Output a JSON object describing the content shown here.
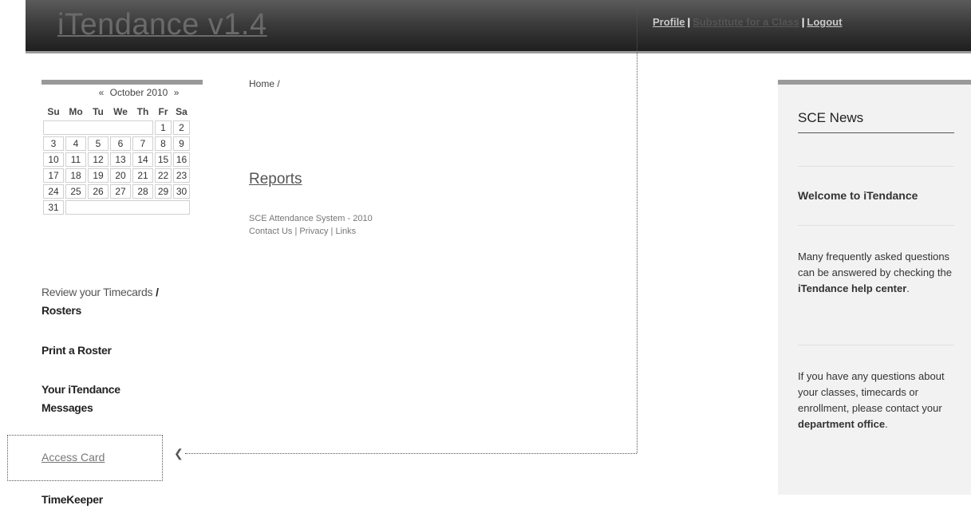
{
  "header": {
    "logo": "iTendance v1.4",
    "nav": {
      "profile": "Profile",
      "substitute": "Substitute for a Class",
      "logout": "Logout",
      "separator": "|"
    }
  },
  "calendar": {
    "prev": "«",
    "month": "October 2010",
    "next": "»",
    "weekdays": [
      "Su",
      "Mo",
      "Tu",
      "We",
      "Th",
      "Fr",
      "Sa"
    ],
    "weeks": [
      [
        "",
        "",
        "",
        "",
        "",
        "1",
        "2"
      ],
      [
        "3",
        "4",
        "5",
        "6",
        "7",
        "8",
        "9"
      ],
      [
        "10",
        "11",
        "12",
        "13",
        "14",
        "15",
        "16"
      ],
      [
        "17",
        "18",
        "19",
        "20",
        "21",
        "22",
        "23"
      ],
      [
        "24",
        "25",
        "26",
        "27",
        "28",
        "29",
        "30"
      ],
      [
        "31",
        "",
        "",
        "",
        "",
        "",
        ""
      ]
    ]
  },
  "leftnav": {
    "review": "Review your Timecards",
    "review_sep": "/",
    "rosters": "Rosters",
    "print_roster": "Print a Roster",
    "messages_line1": "Your iTendance",
    "messages_line2": "Messages",
    "access_card": "Access Card",
    "timekeeper": "TimeKeeper"
  },
  "main": {
    "breadcrumb": "Home /",
    "reports": "Reports",
    "footer_text": "SCE Attendance System - 2010",
    "contact": "Contact Us",
    "privacy": "Privacy",
    "links": "Links",
    "sep": "|"
  },
  "news": {
    "title": "SCE News",
    "welcome": "Welcome to iTendance",
    "faq_text": "Many frequently asked questions can be answered by checking the",
    "faq_link": "iTendance help center",
    "contact_text": "If you have any questions about your classes, timecards or enrollment, please contact your",
    "contact_link": "department office",
    "period": "."
  }
}
